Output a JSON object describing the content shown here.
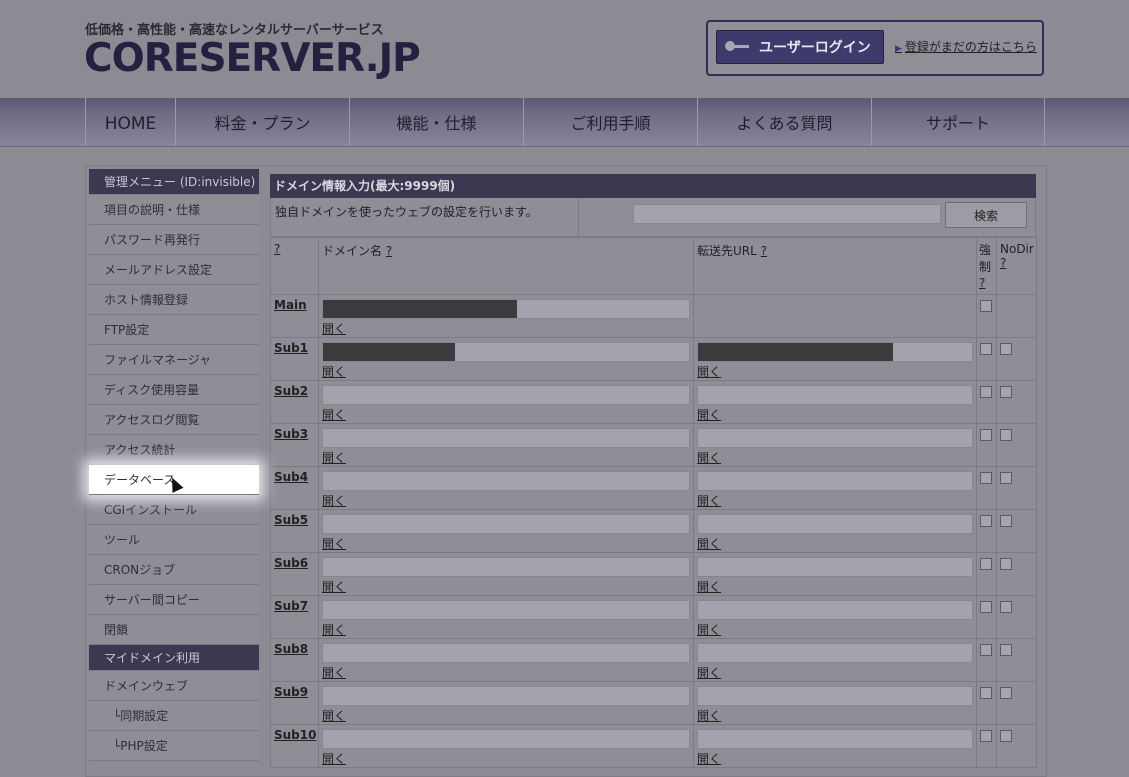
{
  "header": {
    "tagline": "低価格・高性能・高速なレンタルサーバーサービス",
    "logo": "CORESERVER.JP",
    "login_button": "ユーザーログイン",
    "register_link": "登録がまだの方はこちら",
    "login_icon": "key-icon"
  },
  "nav": [
    {
      "label": "HOME"
    },
    {
      "label": "料金・プラン"
    },
    {
      "label": "機能・仕様"
    },
    {
      "label": "ご利用手順"
    },
    {
      "label": "よくある質問"
    },
    {
      "label": "サポート"
    }
  ],
  "sidebar": {
    "section1": "管理メニュー (ID:invisible)",
    "items1": [
      "項目の説明・仕様",
      "パスワード再発行",
      "メールアドレス設定",
      "ホスト情報登録",
      "FTP設定",
      "ファイルマネージャ",
      "ディスク使用容量",
      "アクセスログ閲覧",
      "アクセス統計",
      "データベース",
      "CGIインストール",
      "ツール",
      "CRONジョブ",
      "サーバー間コピー",
      "閉鎖"
    ],
    "active_item": "データベース",
    "section2": "マイドメイン利用",
    "items2": [
      "ドメインウェブ",
      "└同期設定",
      "└PHP設定"
    ]
  },
  "main": {
    "title": "ドメイン情報入力(最大:9999個)",
    "description": "独自ドメインを使ったウェブの設定を行います。",
    "search_placeholder": "",
    "search_button": "検索",
    "columns": {
      "help": "?",
      "domain": "ドメイン名",
      "domain_help": "?",
      "url": "転送先URL",
      "url_help": "?",
      "force": "強制",
      "force_help": "?",
      "nodir": "NoDir",
      "nodir_help": "?"
    },
    "open_label": "開く",
    "rows": [
      {
        "label": "Main",
        "domain_redacted": 0.53,
        "url_redacted": null,
        "has_url": false
      },
      {
        "label": "Sub1",
        "domain_redacted": 0.36,
        "url_redacted": 0.71,
        "has_url": true
      },
      {
        "label": "Sub2",
        "domain_redacted": 0,
        "url_redacted": 0,
        "has_url": true
      },
      {
        "label": "Sub3",
        "domain_redacted": 0,
        "url_redacted": 0,
        "has_url": true
      },
      {
        "label": "Sub4",
        "domain_redacted": 0,
        "url_redacted": 0,
        "has_url": true
      },
      {
        "label": "Sub5",
        "domain_redacted": 0,
        "url_redacted": 0,
        "has_url": true
      },
      {
        "label": "Sub6",
        "domain_redacted": 0,
        "url_redacted": 0,
        "has_url": true
      },
      {
        "label": "Sub7",
        "domain_redacted": 0,
        "url_redacted": 0,
        "has_url": true
      },
      {
        "label": "Sub8",
        "domain_redacted": 0,
        "url_redacted": 0,
        "has_url": true
      },
      {
        "label": "Sub9",
        "domain_redacted": 0,
        "url_redacted": 0,
        "has_url": true
      },
      {
        "label": "Sub10",
        "domain_redacted": 0,
        "url_redacted": 0,
        "has_url": true
      }
    ]
  }
}
